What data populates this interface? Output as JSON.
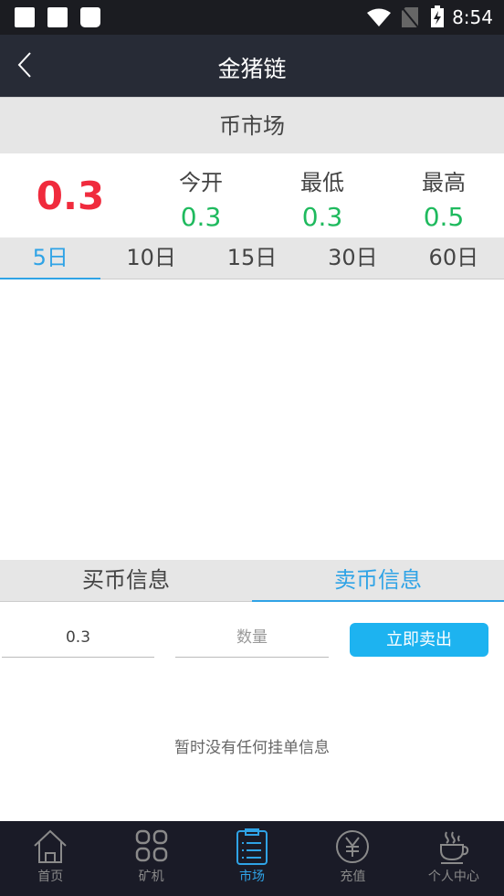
{
  "status_bar": {
    "time": "8:54"
  },
  "header": {
    "title": "金猪链"
  },
  "section_title": "币市场",
  "stats": {
    "current_price": "0.3",
    "items": [
      {
        "label": "今开",
        "value": "0.3"
      },
      {
        "label": "最低",
        "value": "0.3"
      },
      {
        "label": "最高",
        "value": "0.5"
      }
    ]
  },
  "periods": [
    "5日",
    "10日",
    "15日",
    "30日",
    "60日"
  ],
  "active_period": "5日",
  "trade_tabs": [
    "买币信息",
    "卖币信息"
  ],
  "active_trade_tab": "卖币信息",
  "form": {
    "price_value": "0.3",
    "quantity_placeholder": "数量",
    "submit_label": "立即卖出"
  },
  "empty_message": "暂时没有任何挂单信息",
  "nav": [
    {
      "label": "首页",
      "icon": "home-icon"
    },
    {
      "label": "矿机",
      "icon": "grid-icon"
    },
    {
      "label": "市场",
      "icon": "clipboard-list-icon"
    },
    {
      "label": "充值",
      "icon": "yen-circle-icon"
    },
    {
      "label": "个人中心",
      "icon": "coffee-cup-icon"
    }
  ],
  "active_nav": "市场",
  "colors": {
    "accent": "#2fa3e6",
    "price_red": "#f02b3d",
    "stat_green": "#1fba5e",
    "button": "#1db3f0"
  }
}
